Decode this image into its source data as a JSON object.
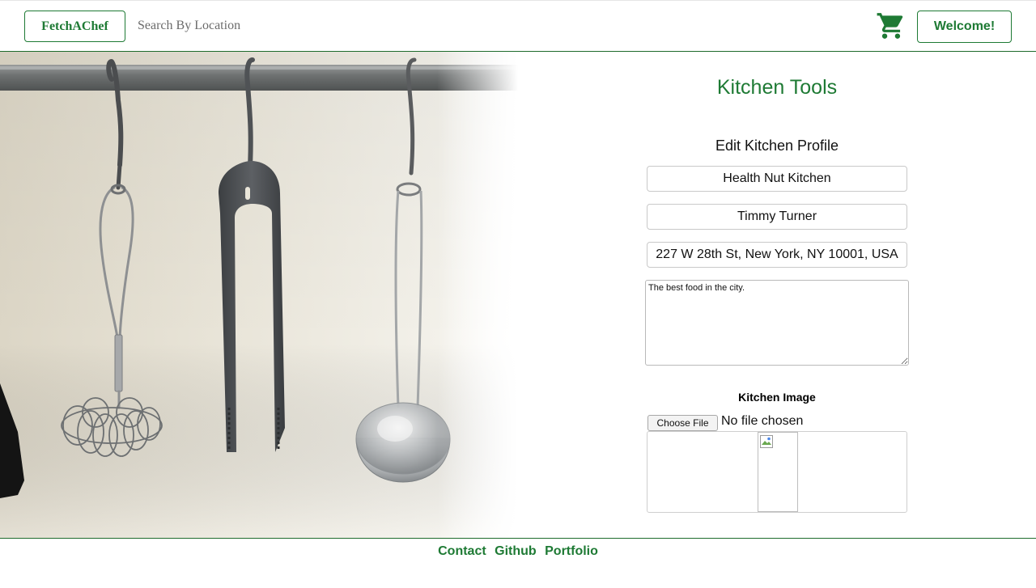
{
  "header": {
    "brand": "FetchAChef",
    "search_placeholder": "Search By Location",
    "cart_icon": "cart-icon",
    "welcome_label": "Welcome!"
  },
  "hero": {
    "image": "kitchen-utensils-photo"
  },
  "panel": {
    "title": "Kitchen Tools",
    "form_heading": "Edit Kitchen Profile",
    "fields": {
      "kitchen_name": "Health Nut Kitchen",
      "owner_name": "Timmy Turner",
      "address": "227 W 28th St, New York, NY 10001, USA",
      "description": "The best food in the city."
    },
    "image_label": "Kitchen Image",
    "choose_file_label": "Choose File",
    "no_file_text": "No file chosen"
  },
  "footer": {
    "links": [
      "Contact",
      "Github",
      "Portfolio"
    ]
  },
  "colors": {
    "brand_green": "#1e7a34"
  }
}
